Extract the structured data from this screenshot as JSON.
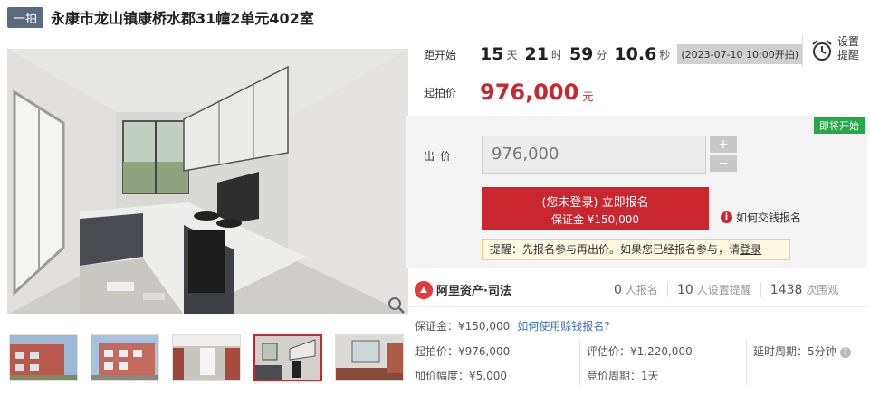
{
  "header": {
    "round_badge": "一拍",
    "title": "永康市龙山镇康桥水郡31幢2单元402室"
  },
  "countdown": {
    "label": "距开始",
    "days": "15",
    "days_unit": "天",
    "hours": "21",
    "hours_unit": "时",
    "minutes": "59",
    "minutes_unit": "分",
    "seconds": "10.6",
    "seconds_unit": "秒",
    "start_time": "(2023-07-10 10:00开拍)",
    "remind_label": "设置提醒"
  },
  "start_price": {
    "label": "起拍价",
    "value": "976,000",
    "unit": "元"
  },
  "bid": {
    "status_badge": "即将开始",
    "label": "出价",
    "input_value": "976,000",
    "plus": "+",
    "minus": "−",
    "signup_main": "(您未登录) 立即报名",
    "signup_sub": "保证金 ¥150,000",
    "howto": "如何交钱报名",
    "tip_prefix": "提醒：先报名参与再出价。如果您已经报名参与，请",
    "tip_login": "登录"
  },
  "stats": {
    "brand": "阿里资产·司法",
    "signups_num": "0",
    "signups_label": "人报名",
    "reminders_num": "10",
    "reminders_label": "人设置提醒",
    "views_num": "1438",
    "views_label": "次围观"
  },
  "info": {
    "deposit": "保证金：¥150,000",
    "deposit_link": "如何使用赊钱报名?",
    "start_price": "起拍价：¥976,000",
    "appraisal": "评估价：¥1,220,000",
    "extension": "延时周期：5分钟",
    "increment": "加价幅度：¥5,000",
    "bidding_period": "竞价周期：1天"
  },
  "colors": {
    "accent_red": "#c9262f",
    "badge_green": "#25a74a",
    "link_blue": "#3a6fc4"
  }
}
